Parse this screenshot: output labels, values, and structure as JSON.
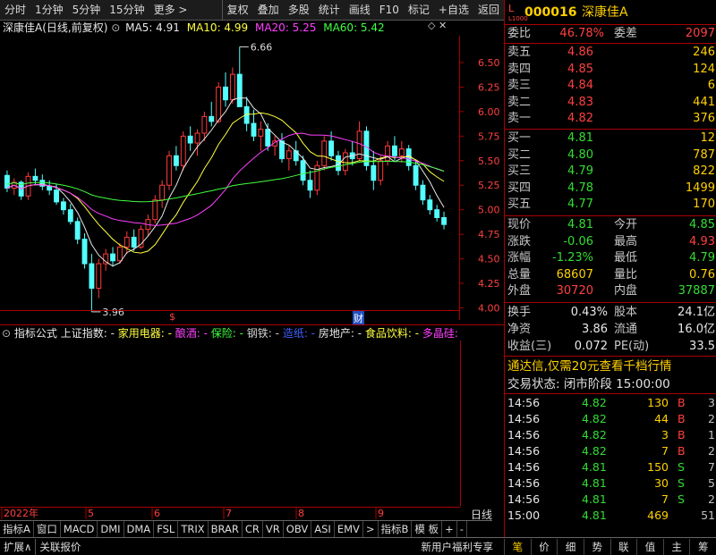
{
  "toolbar": {
    "left": [
      "分时",
      "1分钟",
      "5分钟",
      "15分钟",
      "更多 >"
    ],
    "right": [
      "复权",
      "叠加",
      "多股",
      "统计",
      "画线",
      "F10",
      "标记",
      "+自选",
      "返回"
    ]
  },
  "title": {
    "stock": "深康佳A",
    "mode": "(日线,前复权)",
    "ma5": "MA5: 4.91",
    "ma10": "MA10: 4.99",
    "ma20": "MA20: 5.25",
    "ma60": "MA60: 5.42"
  },
  "colors": {
    "up": "#ff3b3b",
    "down": "#54ffff",
    "ma5": "#e8e8e8",
    "ma10": "#ffff40",
    "ma20": "#ff40ff",
    "ma60": "#40ff40",
    "border": "#aa0000"
  },
  "chart_data": {
    "type": "candlestick",
    "y_ticks": [
      "6.50",
      "6.25",
      "6.00",
      "5.75",
      "5.50",
      "5.25",
      "5.00",
      "4.75",
      "4.50",
      "4.25",
      "4.00"
    ],
    "ylim": [
      3.95,
      6.7
    ],
    "annotations": {
      "high": "6.66",
      "low": "3.96"
    },
    "x_months": [
      "2022年",
      "5",
      "6",
      "7",
      "8",
      "9"
    ],
    "markers": [
      "$",
      "财"
    ],
    "candles": [
      [
        5.35,
        5.4,
        5.18,
        5.22
      ],
      [
        5.22,
        5.32,
        5.15,
        5.28
      ],
      [
        5.28,
        5.3,
        5.1,
        5.14
      ],
      [
        5.14,
        5.38,
        5.1,
        5.34
      ],
      [
        5.34,
        5.42,
        5.25,
        5.3
      ],
      [
        5.3,
        5.36,
        5.2,
        5.24
      ],
      [
        5.24,
        5.3,
        5.15,
        5.2
      ],
      [
        5.2,
        5.26,
        5.05,
        5.08
      ],
      [
        5.08,
        5.12,
        4.95,
        5.0
      ],
      [
        5.0,
        5.06,
        4.85,
        4.88
      ],
      [
        4.88,
        4.92,
        4.65,
        4.7
      ],
      [
        4.7,
        4.76,
        4.4,
        4.45
      ],
      [
        4.45,
        4.55,
        3.96,
        4.2
      ],
      [
        4.2,
        4.5,
        4.1,
        4.45
      ],
      [
        4.45,
        4.6,
        4.38,
        4.55
      ],
      [
        4.55,
        4.62,
        4.42,
        4.48
      ],
      [
        4.48,
        4.66,
        4.45,
        4.62
      ],
      [
        4.62,
        4.78,
        4.55,
        4.72
      ],
      [
        4.72,
        4.8,
        4.58,
        4.62
      ],
      [
        4.62,
        4.84,
        4.6,
        4.8
      ],
      [
        4.8,
        4.95,
        4.74,
        4.9
      ],
      [
        4.9,
        5.15,
        4.86,
        5.1
      ],
      [
        5.1,
        5.3,
        5.02,
        5.25
      ],
      [
        5.25,
        5.6,
        5.2,
        5.55
      ],
      [
        5.55,
        5.65,
        5.4,
        5.45
      ],
      [
        5.45,
        5.8,
        5.4,
        5.75
      ],
      [
        5.75,
        5.85,
        5.6,
        5.68
      ],
      [
        5.68,
        5.82,
        5.55,
        5.78
      ],
      [
        5.78,
        6.0,
        5.7,
        5.95
      ],
      [
        5.95,
        6.1,
        5.85,
        5.9
      ],
      [
        5.9,
        6.3,
        5.88,
        6.25
      ],
      [
        6.25,
        6.4,
        6.05,
        6.12
      ],
      [
        6.12,
        6.45,
        6.08,
        6.38
      ],
      [
        6.38,
        6.66,
        6.3,
        6.05
      ],
      [
        6.05,
        6.15,
        5.8,
        5.88
      ],
      [
        5.88,
        6.02,
        5.7,
        5.75
      ],
      [
        5.75,
        5.9,
        5.6,
        5.82
      ],
      [
        5.82,
        5.88,
        5.6,
        5.65
      ],
      [
        5.65,
        5.75,
        5.55,
        5.7
      ],
      [
        5.7,
        5.78,
        5.48,
        5.52
      ],
      [
        5.52,
        5.65,
        5.4,
        5.6
      ],
      [
        5.6,
        5.7,
        5.45,
        5.5
      ],
      [
        5.5,
        5.55,
        5.25,
        5.3
      ],
      [
        5.3,
        5.4,
        5.12,
        5.2
      ],
      [
        5.2,
        5.5,
        5.15,
        5.45
      ],
      [
        5.45,
        5.75,
        5.4,
        5.7
      ],
      [
        5.7,
        5.8,
        5.5,
        5.55
      ],
      [
        5.55,
        5.6,
        5.35,
        5.4
      ],
      [
        5.4,
        5.62,
        5.35,
        5.58
      ],
      [
        5.58,
        5.7,
        5.45,
        5.52
      ],
      [
        5.52,
        5.9,
        5.5,
        5.8
      ],
      [
        5.8,
        5.85,
        5.4,
        5.45
      ],
      [
        5.45,
        5.6,
        5.2,
        5.3
      ],
      [
        5.3,
        5.55,
        5.25,
        5.5
      ],
      [
        5.5,
        5.7,
        5.45,
        5.65
      ],
      [
        5.65,
        5.75,
        5.5,
        5.55
      ],
      [
        5.55,
        5.7,
        5.48,
        5.62
      ],
      [
        5.62,
        5.66,
        5.4,
        5.45
      ],
      [
        5.45,
        5.5,
        5.2,
        5.25
      ],
      [
        5.25,
        5.3,
        5.05,
        5.1
      ],
      [
        5.1,
        5.15,
        4.95,
        5.0
      ],
      [
        5.0,
        5.05,
        4.88,
        4.92
      ],
      [
        4.92,
        4.98,
        4.8,
        4.85
      ]
    ]
  },
  "indicator": {
    "label": "指标公式",
    "items": [
      {
        "name": "上证指数",
        "color": "#e8e8e8"
      },
      {
        "name": "家用电器",
        "color": "#ffff40"
      },
      {
        "name": "酿酒",
        "color": "#ff40ff"
      },
      {
        "name": "保险",
        "color": "#40ff40"
      },
      {
        "name": "钢铁",
        "color": "#d0d0d0"
      },
      {
        "name": "造纸",
        "color": "#4060ff"
      },
      {
        "name": "房地产",
        "color": "#e8e8e8"
      },
      {
        "name": "食品饮料",
        "color": "#ffff40"
      },
      {
        "name": "多晶硅",
        "color": "#ff40ff"
      }
    ],
    "day_label": "日线"
  },
  "bottom_tabs": [
    "指标A",
    "窗口",
    "MACD",
    "DMI",
    "DMA",
    "FSL",
    "TRIX",
    "BRAR",
    "CR",
    "VR",
    "OBV",
    "ASI",
    "EMV",
    ">",
    "指标B",
    "模 板",
    "+",
    "-"
  ],
  "bottom_bar": {
    "left": [
      "扩展∧",
      "关联报价"
    ],
    "promo": "新用户福利专享",
    "right": [
      "笔",
      "价",
      "细",
      "势",
      "联",
      "值",
      "主",
      "筹"
    ]
  },
  "quote": {
    "code": "000016",
    "name": "深康佳A",
    "level_badge": "L1000",
    "weibi_label": "委比",
    "weibi": "46.78%",
    "weicha_label": "委差",
    "weicha": "2097",
    "sells": [
      {
        "label": "卖五",
        "price": "4.86",
        "vol": "246"
      },
      {
        "label": "卖四",
        "price": "4.85",
        "vol": "124"
      },
      {
        "label": "卖三",
        "price": "4.84",
        "vol": "6"
      },
      {
        "label": "卖二",
        "price": "4.83",
        "vol": "441"
      },
      {
        "label": "卖一",
        "price": "4.82",
        "vol": "376"
      }
    ],
    "buys": [
      {
        "label": "买一",
        "price": "4.81",
        "vol": "12"
      },
      {
        "label": "买二",
        "price": "4.80",
        "vol": "787"
      },
      {
        "label": "买三",
        "price": "4.79",
        "vol": "822"
      },
      {
        "label": "买四",
        "price": "4.78",
        "vol": "1499"
      },
      {
        "label": "买五",
        "price": "4.77",
        "vol": "170"
      }
    ],
    "stats": [
      {
        "l1": "现价",
        "v1": "4.81",
        "c1": "green",
        "l2": "今开",
        "v2": "4.85",
        "c2": "green"
      },
      {
        "l1": "涨跌",
        "v1": "-0.06",
        "c1": "green",
        "l2": "最高",
        "v2": "4.93",
        "c2": "red"
      },
      {
        "l1": "涨幅",
        "v1": "-1.23%",
        "c1": "green",
        "l2": "最低",
        "v2": "4.79",
        "c2": "green"
      },
      {
        "l1": "总量",
        "v1": "68607",
        "c1": "yellow",
        "l2": "量比",
        "v2": "0.76",
        "c2": "yellow"
      },
      {
        "l1": "外盘",
        "v1": "30720",
        "c1": "red",
        "l2": "内盘",
        "v2": "37887",
        "c2": "green"
      }
    ],
    "stats2": [
      {
        "l1": "换手",
        "v1": "0.43%",
        "l2": "股本",
        "v2": "24.1亿"
      },
      {
        "l1": "净资",
        "v1": "3.86",
        "l2": "流通",
        "v2": "16.0亿"
      },
      {
        "l1": "收益(三)",
        "v1": "0.072",
        "l2": "PE(动)",
        "v2": "33.5"
      }
    ],
    "promo": "通达信,仅需20元查看千档行情",
    "status": "交易状态: 闭市阶段 15:00:00",
    "ticks": [
      {
        "t": "14:56",
        "p": "4.82",
        "v": "130",
        "s": "B",
        "n": "3"
      },
      {
        "t": "14:56",
        "p": "4.82",
        "v": "44",
        "s": "B",
        "n": "2"
      },
      {
        "t": "14:56",
        "p": "4.82",
        "v": "3",
        "s": "B",
        "n": "1"
      },
      {
        "t": "14:56",
        "p": "4.82",
        "v": "7",
        "s": "B",
        "n": "2"
      },
      {
        "t": "14:56",
        "p": "4.81",
        "v": "150",
        "s": "S",
        "n": "7"
      },
      {
        "t": "14:56",
        "p": "4.81",
        "v": "30",
        "s": "S",
        "n": "5"
      },
      {
        "t": "14:56",
        "p": "4.81",
        "v": "7",
        "s": "S",
        "n": "2"
      },
      {
        "t": "15:00",
        "p": "4.81",
        "v": "469",
        "s": "",
        "n": "51"
      }
    ]
  }
}
